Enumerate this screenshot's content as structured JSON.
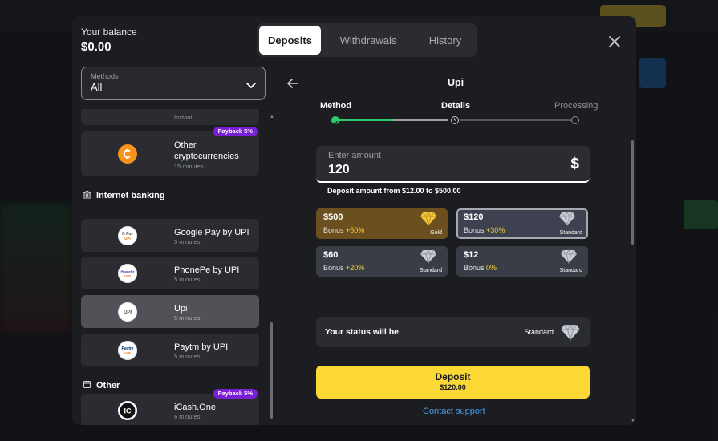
{
  "balance": {
    "label": "Your balance",
    "value": "$0.00"
  },
  "tabs": [
    {
      "label": "Deposits",
      "active": true
    },
    {
      "label": "Withdrawals",
      "active": false
    },
    {
      "label": "History",
      "active": false
    }
  ],
  "methods": {
    "label": "Methods",
    "value": "All"
  },
  "list": {
    "partial_top_time": "Instant",
    "crypto": {
      "name_line1": "Other",
      "name_line2": "cryptocurrencies",
      "time": "15 minutes",
      "badge": "Payback 5%",
      "icon": "crypto-coin-icon"
    },
    "internet_banking_header": "Internet banking",
    "banking_items": [
      {
        "name": "Google Pay by UPI",
        "time": "5 minutes",
        "logo": "G Pay UPI"
      },
      {
        "name": "PhonePe by UPI",
        "time": "5 minutes",
        "logo": "PhonePe UPI"
      },
      {
        "name": "Upi",
        "time": "5 minutes",
        "logo": "UPI",
        "selected": true
      },
      {
        "name": "Paytm by UPI",
        "time": "5 minutes",
        "logo": "Paytm UPI"
      }
    ],
    "other_header": "Other",
    "other_items": [
      {
        "name": "iCash.One",
        "time": "6 minutes",
        "badge": "Payback 5%",
        "logo": "IC"
      }
    ]
  },
  "panel": {
    "title": "Upi",
    "steps": [
      {
        "label": "Method",
        "state": "done"
      },
      {
        "label": "Details",
        "state": "current"
      },
      {
        "label": "Processing",
        "state": "pending"
      }
    ],
    "amount": {
      "label": "Enter amount",
      "value": "120",
      "currency": "$",
      "hint": "Deposit amount from $12.00 to $500.00"
    },
    "bonus_options": [
      {
        "amount": "$500",
        "bonus_prefix": "Bonus",
        "bonus_pct": "+50%",
        "tier": "Gold"
      },
      {
        "amount": "$120",
        "bonus_prefix": "Bonus",
        "bonus_pct": "+30%",
        "tier": "Standard",
        "selected": true
      },
      {
        "amount": "$60",
        "bonus_prefix": "Bonus",
        "bonus_pct": "+20%",
        "tier": "Standard"
      },
      {
        "amount": "$12",
        "bonus_prefix": "Bonus",
        "bonus_pct": "0%",
        "tier": "Standard"
      }
    ],
    "status": {
      "label": "Your status will be",
      "tier": "Standard"
    },
    "deposit_button": {
      "label": "Deposit",
      "amount": "$120.00"
    },
    "contact_link": "Contact support"
  },
  "colors": {
    "accent_yellow": "#fbd834",
    "payback_purple": "#7b1fd6",
    "step_green": "#2ecc71",
    "link_blue": "#4a9be8"
  }
}
